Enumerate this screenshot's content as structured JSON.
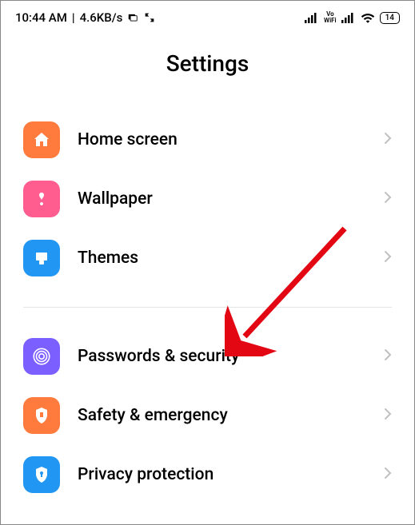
{
  "status_bar": {
    "time": "10:44 AM",
    "separator": " | ",
    "data_rate": "4.6KB/s",
    "vowifi_label_top": "Vo",
    "vowifi_label_bottom": "WiFi",
    "battery_level": "14"
  },
  "title": "Settings",
  "group1": [
    {
      "label": "Home screen"
    },
    {
      "label": "Wallpaper"
    },
    {
      "label": "Themes"
    }
  ],
  "group2": [
    {
      "label": "Passwords & security"
    },
    {
      "label": "Safety & emergency"
    },
    {
      "label": "Privacy protection"
    }
  ]
}
